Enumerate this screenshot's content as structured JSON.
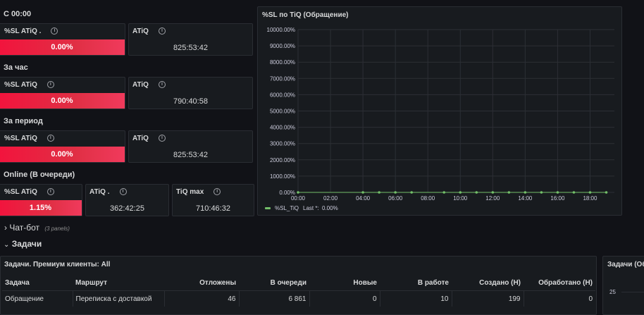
{
  "groups": [
    {
      "title": "С 00:00",
      "sl_label": "%SL ATiQ .",
      "sl_value": "0.00%",
      "atiq_label": "ATiQ",
      "atiq_value": "825:53:42"
    },
    {
      "title": "За час",
      "sl_label": "%SL ATiQ",
      "sl_value": "0.00%",
      "atiq_label": "ATiQ",
      "atiq_value": "790:40:58"
    },
    {
      "title": "За период",
      "sl_label": "%SL ATiQ",
      "sl_value": "0.00%",
      "atiq_label": "ATiQ",
      "atiq_value": "825:53:42"
    }
  ],
  "online": {
    "title": "Online (В очереди)",
    "sl_label": "%SL ATiQ",
    "sl_value": "1.15%",
    "atiq_label": "ATiQ .",
    "atiq_value": "362:42:25",
    "tiq_label": "TiQ max",
    "tiq_value": "710:46:32"
  },
  "chart_panel_title": "%SL по TiQ (Обращение)",
  "chart_data": {
    "type": "line",
    "title": "%SL по TiQ (Обращение)",
    "y_ticks": [
      "10000.00%",
      "9000.00%",
      "8000.00%",
      "7000.00%",
      "6000.00%",
      "5000.00%",
      "4000.00%",
      "3000.00%",
      "2000.00%",
      "1000.00%",
      "0.00%"
    ],
    "x_ticks": [
      "00:00",
      "02:00",
      "04:00",
      "06:00",
      "08:00",
      "10:00",
      "12:00",
      "14:00",
      "16:00",
      "18:00"
    ],
    "ylim": [
      0,
      10000
    ],
    "xlim": [
      0,
      19.5
    ],
    "series": [
      {
        "name": "%SL_TiQ",
        "color": "#73bf69",
        "x": [
          0,
          4,
          5,
          6,
          7,
          9,
          10,
          11,
          12,
          13,
          14,
          15,
          16,
          17,
          18,
          19
        ],
        "y": [
          0,
          0,
          0,
          0,
          0,
          0,
          0,
          0,
          0,
          0,
          0,
          0,
          0,
          0,
          0,
          0
        ]
      }
    ],
    "legend": {
      "name": "%SL_TiQ",
      "last_label": "Last *:",
      "last_value": "0.00%"
    }
  },
  "chatbot_row": {
    "chevron": "›",
    "title": "Чат-бот",
    "note": "(3 panels)"
  },
  "tasks_row": {
    "chevron": "⌄",
    "title": "Задачи"
  },
  "tasks_table": {
    "title": "Задачи. Премиум клиенты: All",
    "columns": [
      "Задача",
      "Маршрут",
      "Отложены",
      "В очереди",
      "Новые",
      "В работе",
      "Создано (Н)",
      "Обработано (Н)"
    ],
    "rows": [
      [
        "Обращение",
        "Переписка с доставкой",
        "46",
        "6 861",
        "0",
        "10",
        "199",
        "0"
      ]
    ]
  },
  "right_panel": {
    "title": "Задачи (Об",
    "tick": "25"
  }
}
